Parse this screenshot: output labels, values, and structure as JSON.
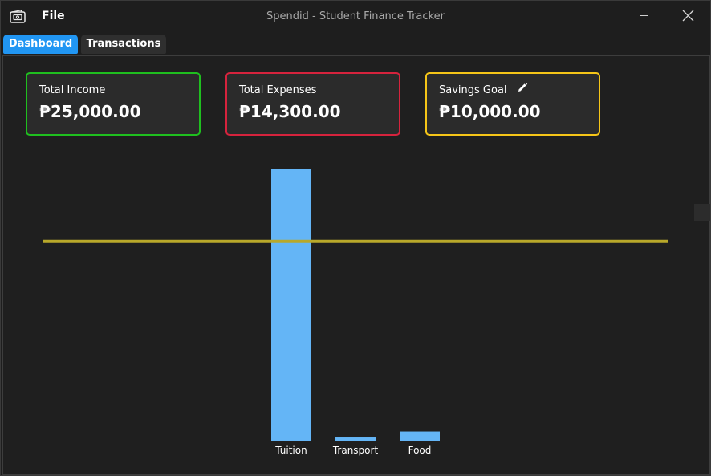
{
  "window": {
    "title": "Spendid - Student Finance Tracker",
    "menu": {
      "file_label": "File"
    },
    "icons": {
      "app": "wallet-icon",
      "minimize": "minimize-icon",
      "close": "close-icon"
    }
  },
  "tabs": [
    {
      "label": "Dashboard",
      "active": true
    },
    {
      "label": "Transactions",
      "active": false
    }
  ],
  "cards": {
    "income": {
      "label": "Total Income",
      "value": "₱25,000.00",
      "border_color": "#1fbf1f"
    },
    "expenses": {
      "label": "Total Expenses",
      "value": "₱14,300.00",
      "border_color": "#d6233d"
    },
    "savings": {
      "label": "Savings Goal",
      "value": "₱10,000.00",
      "border_color": "#f5c518",
      "edit_icon": "pencil-icon"
    }
  },
  "colors": {
    "accent": "#2196f3",
    "bar": "#64b5f6",
    "goal_line": "#b8a82a",
    "background": "#1e1e1e"
  },
  "chart_data": {
    "type": "bar",
    "categories": [
      "Tuition",
      "Transport",
      "Food"
    ],
    "values": [
      13600,
      200,
      500
    ],
    "reference_line": {
      "value": 10000
    },
    "ylim": [
      0,
      13600
    ],
    "grid": false,
    "legend": "none"
  }
}
